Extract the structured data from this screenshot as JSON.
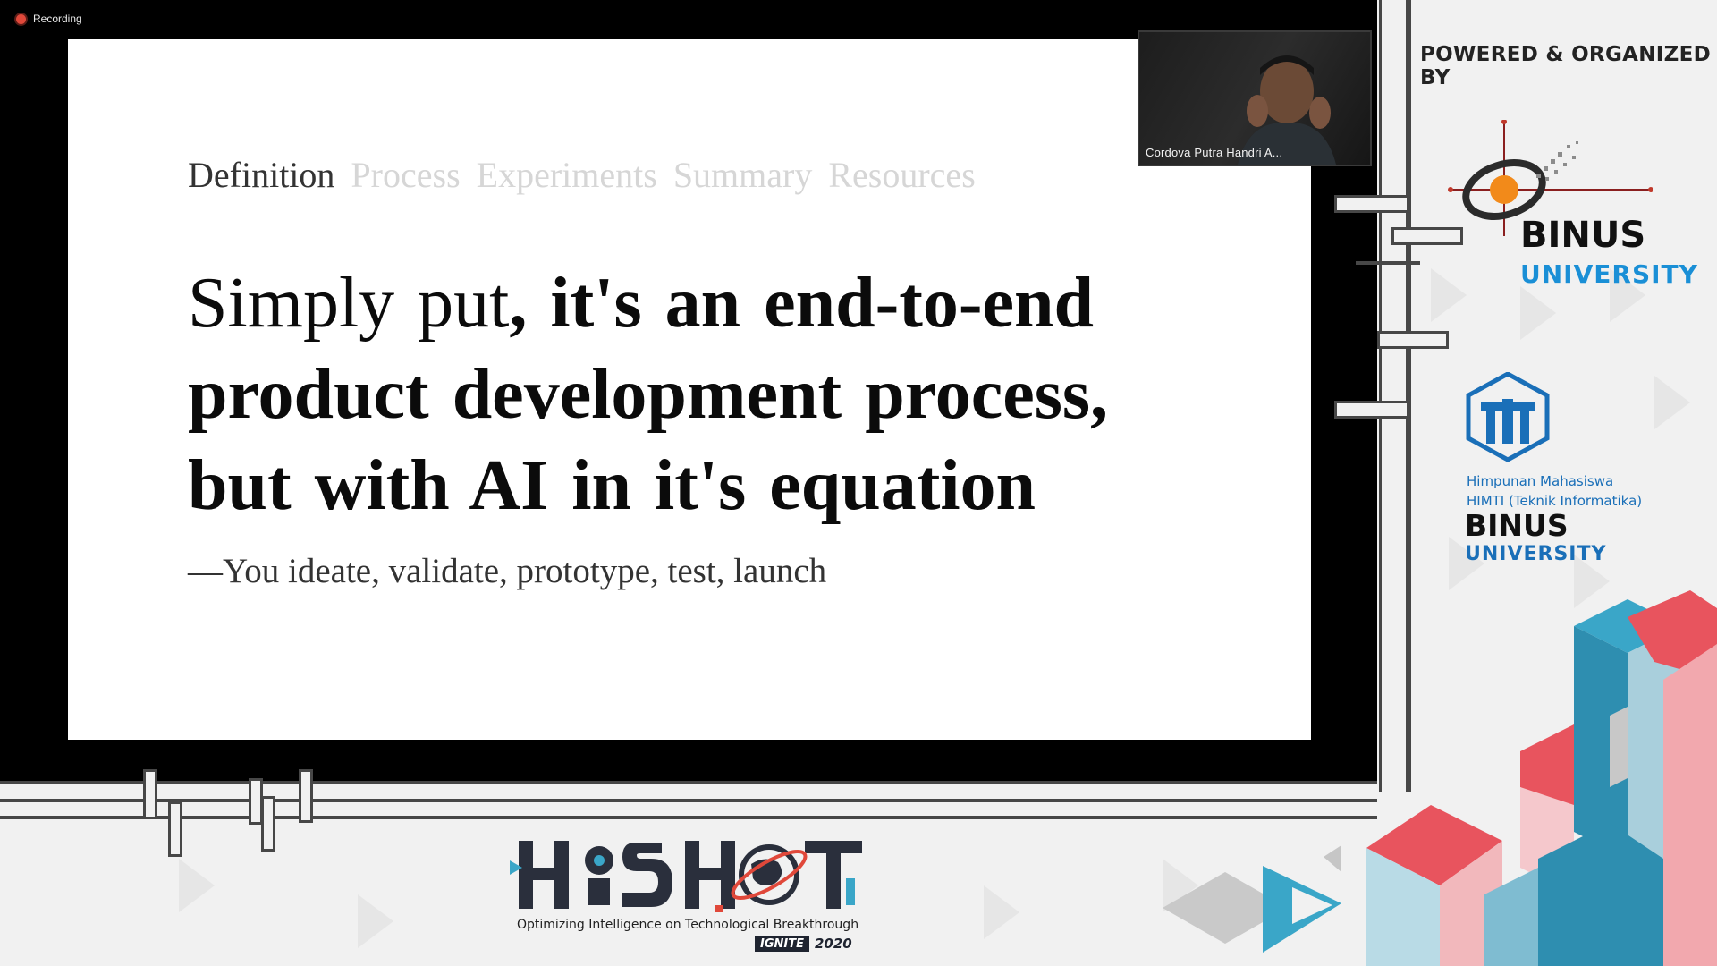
{
  "recording": {
    "label": "Recording"
  },
  "slide": {
    "nav": {
      "active": "Definition",
      "inactive": [
        "Process",
        "Experiments",
        "Summary",
        "Resources"
      ]
    },
    "headline": {
      "light": "Simply put",
      "bold": ", it's an end-to-end product development process, but with AI in it's equation"
    },
    "subline": "—You ideate, validate, prototype, test, launch"
  },
  "video": {
    "participant_name": "Cordova Putra Handri A..."
  },
  "sponsor_panel": {
    "heading": "POWERED & ORGANIZED BY",
    "binus": {
      "name": "BINUS",
      "sub": "UNIVERSITY"
    },
    "himti": {
      "line1": "Himpunan Mahasiswa",
      "line2": "HIMTI (Teknik Informatika)",
      "name": "BINUS",
      "sub": "UNIVERSITY"
    }
  },
  "event": {
    "tagline": "Optimizing Intelligence on Technological Breakthrough",
    "badge": "IGNITE",
    "year": "2020"
  },
  "colors": {
    "accent_blue": "#1a8fd6",
    "orange": "#f28a1a",
    "red": "#e0483a",
    "teal": "#3aa6c8"
  }
}
